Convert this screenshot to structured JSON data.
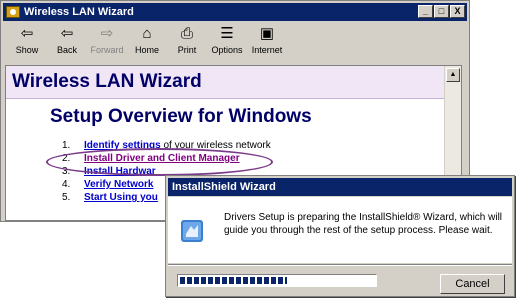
{
  "window": {
    "title": "Wireless LAN Wizard",
    "controls": {
      "minimize": "_",
      "maximize": "□",
      "close": "X"
    }
  },
  "toolbar": {
    "buttons": [
      {
        "label": "Show",
        "icon": "show-icon",
        "glyph": "⇦",
        "disabled": false
      },
      {
        "label": "Back",
        "icon": "back-arrow-icon",
        "glyph": "⇦",
        "disabled": false
      },
      {
        "label": "Forward",
        "icon": "forward-arrow-icon",
        "glyph": "⇨",
        "disabled": true
      },
      {
        "label": "Home",
        "icon": "home-icon",
        "glyph": "⌂",
        "disabled": false
      },
      {
        "label": "Print",
        "icon": "printer-icon",
        "glyph": "⎙",
        "disabled": false
      },
      {
        "label": "Options",
        "icon": "options-icon",
        "glyph": "☰",
        "disabled": false
      },
      {
        "label": "Internet",
        "icon": "internet-icon",
        "glyph": "▣",
        "disabled": false
      }
    ]
  },
  "content": {
    "banner_title": "Wireless LAN Wizard",
    "subtitle": "Setup Overview for Windows",
    "steps": [
      {
        "num": "1.",
        "link": "Identify settings",
        "rest": " of your wireless network"
      },
      {
        "num": "2.",
        "link": "Install Driver and Client Manager",
        "rest": "",
        "selected": true
      },
      {
        "num": "3.",
        "link": "Install Hardwar",
        "rest": ""
      },
      {
        "num": "4.",
        "link": "Verify Network",
        "rest": ""
      },
      {
        "num": "5.",
        "link": "Start Using you",
        "rest": ""
      }
    ],
    "highlight_color": "#7a3c8a",
    "link_color": "#0000cc",
    "visited_color": "#800080"
  },
  "dialog": {
    "title": "InstallShield Wizard",
    "message": "Drivers Setup is preparing the InstallShield® Wizard, which will guide you through the rest of the setup process. Please wait.",
    "progress": 0.55,
    "cancel_label": "Cancel",
    "icon": "installshield-icon"
  },
  "colors": {
    "title_bar": "#0a246a",
    "banner_bg": "#f1e6f6",
    "heading": "#000066"
  }
}
